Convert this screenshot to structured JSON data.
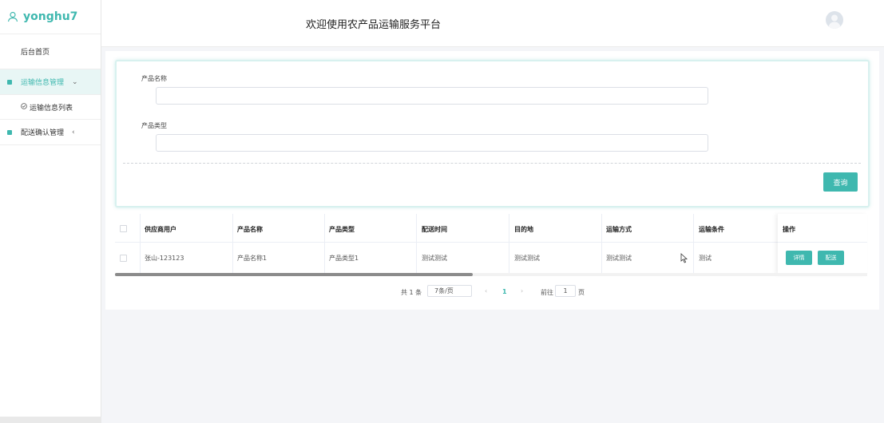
{
  "sidebar": {
    "user": "yonghu7",
    "home": "后台首页",
    "groups": [
      {
        "label": "运输信息管理",
        "arrow": "⌄",
        "sub": "运输信息列表"
      },
      {
        "label": "配送确认管理",
        "arrow": "‹"
      }
    ]
  },
  "header": {
    "title": "欢迎使用农产品运输服务平台"
  },
  "search": {
    "name_label": "产品名称",
    "name_value": "",
    "type_label": "产品类型",
    "type_value": "",
    "query_button": "查询"
  },
  "table": {
    "columns": [
      "供应商用户",
      "产品名称",
      "产品类型",
      "配送时间",
      "目的地",
      "运输方式",
      "运输条件",
      "操作"
    ],
    "rows": [
      {
        "cells": [
          "张山-123123",
          "产品名称1",
          "产品类型1",
          "测试测试",
          "测试测试",
          "测试测试",
          "测试"
        ],
        "actions": [
          "详情",
          "配送"
        ]
      }
    ]
  },
  "pagination": {
    "total": "共 1 条",
    "page_size": "7条/页",
    "prev": "‹",
    "current_page": "1",
    "next": "›",
    "goto_label": "前往",
    "goto_value": "1",
    "goto_unit": "页"
  },
  "colors": {
    "accent": "#3fb8af"
  },
  "icons": [
    "user-icon",
    "menu-dot-icon",
    "chevron-down-icon",
    "chevron-left-icon",
    "check-circle-icon",
    "avatar-icon"
  ]
}
